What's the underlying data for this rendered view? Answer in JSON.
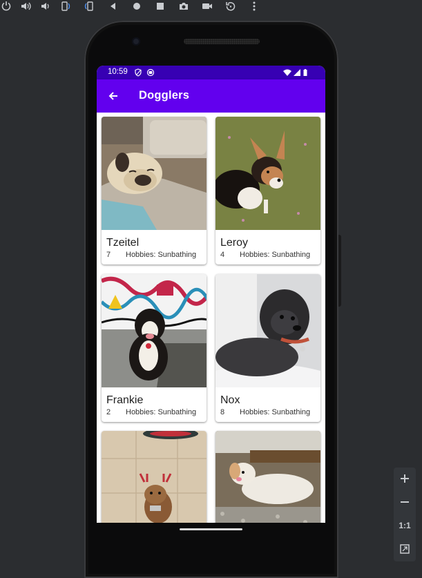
{
  "status_bar": {
    "time": "10:59"
  },
  "app_bar": {
    "title": "Dogglers"
  },
  "dogs": [
    {
      "name": "Tzeitel",
      "age": "7",
      "hobbies": "Hobbies: Sunbathing"
    },
    {
      "name": "Leroy",
      "age": "4",
      "hobbies": "Hobbies: Sunbathing"
    },
    {
      "name": "Frankie",
      "age": "2",
      "hobbies": "Hobbies: Sunbathing"
    },
    {
      "name": "Nox",
      "age": "8",
      "hobbies": "Hobbies: Sunbathing"
    },
    {
      "name": "",
      "age": "",
      "hobbies": ""
    },
    {
      "name": "",
      "age": "",
      "hobbies": ""
    }
  ],
  "zoom_controls": {
    "one_to_one": "1:1"
  },
  "icons": {
    "toolbar": [
      "power-icon",
      "volume-up-icon",
      "volume-down-icon",
      "rotate-left-icon",
      "rotate-right-icon",
      "back-icon",
      "home-icon",
      "overview-icon",
      "camera-icon",
      "video-icon",
      "replay-icon",
      "more-icon"
    ],
    "status": [
      "shield-icon",
      "sync-icon",
      "wifi-icon",
      "signal-icon",
      "battery-icon"
    ],
    "app_bar": "arrow-back-icon"
  },
  "colors": {
    "status_bar": "#3700b3",
    "app_bar": "#6200ee",
    "background": "#2b2d30"
  }
}
